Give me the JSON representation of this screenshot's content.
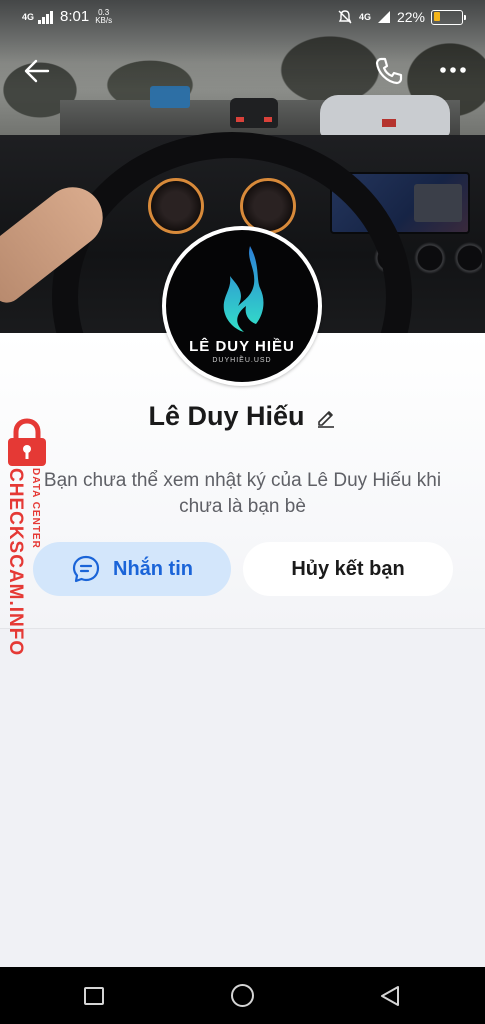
{
  "status_bar": {
    "network": "4G",
    "time": "8:01",
    "speed_value": "0.3",
    "speed_unit": "KB/s",
    "network_right": "4G",
    "battery_percent": "22%",
    "battery_level": 0.22
  },
  "header": {
    "back_icon": "arrow-left-icon",
    "call_icon": "phone-icon",
    "more_icon": "more-dots-icon"
  },
  "profile": {
    "avatar_logo_name": "LÊ DUY HIỀU",
    "avatar_logo_sub": "DUYHIỀU.USD",
    "name": "Lê Duy Hiếu",
    "edit_icon": "pencil-icon",
    "notice": "Bạn chưa thể xem nhật ký của Lê Duy Hiếu khi chưa là bạn bè"
  },
  "actions": {
    "message_label": "Nhắn tin",
    "message_icon": "chat-bubble-icon",
    "unfriend_label": "Hủy kết bạn"
  },
  "watermark": {
    "main": "CHECKSCAM.INFO",
    "sub": "DATA CENTER",
    "color": "#e53935"
  },
  "colors": {
    "accent": "#1a64d8",
    "message_button_bg": "#d3e6fb",
    "battery_fill": "#f3b51b"
  },
  "nav_bar": {
    "recent_icon": "square-icon",
    "home_icon": "circle-icon",
    "back_icon": "triangle-back-icon"
  }
}
